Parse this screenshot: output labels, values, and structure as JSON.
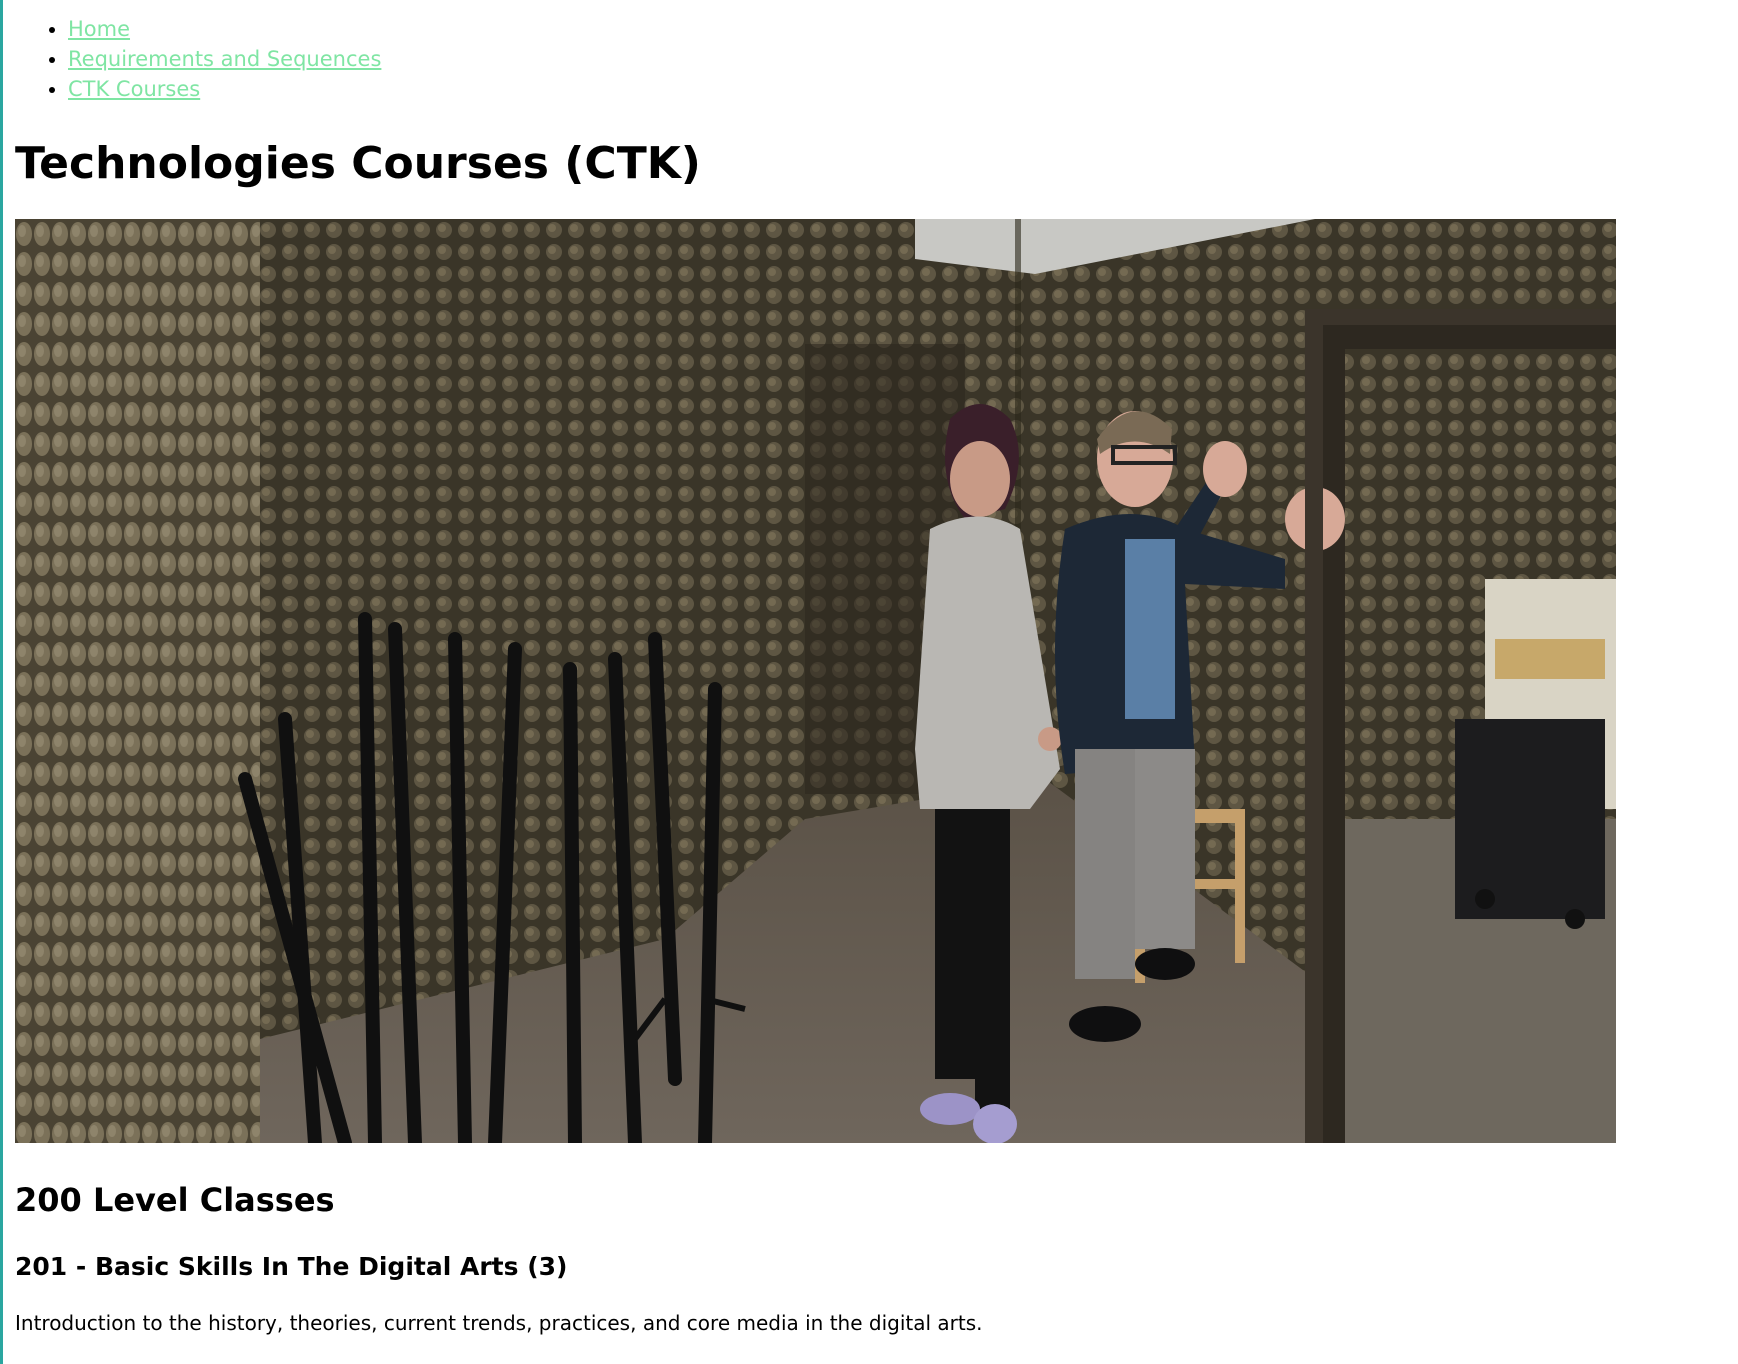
{
  "nav": {
    "items": [
      {
        "label": "Home"
      },
      {
        "label": "Requirements and Sequences"
      },
      {
        "label": "CTK Courses"
      }
    ]
  },
  "page": {
    "title": "Technologies Courses (CTK)"
  },
  "hero_image": {
    "icon": "photo-acoustic-studio",
    "description_visible": false
  },
  "section": {
    "heading": "200 Level Classes",
    "course_title": "201 - Basic Skills In The Digital Arts (3)",
    "course_description": "Introduction to the history, theories, current trends, practices, and core media in the digital arts."
  },
  "colors": {
    "link": "#7fe5a3",
    "text": "#000000",
    "left_rule": "#2aa6a0"
  }
}
